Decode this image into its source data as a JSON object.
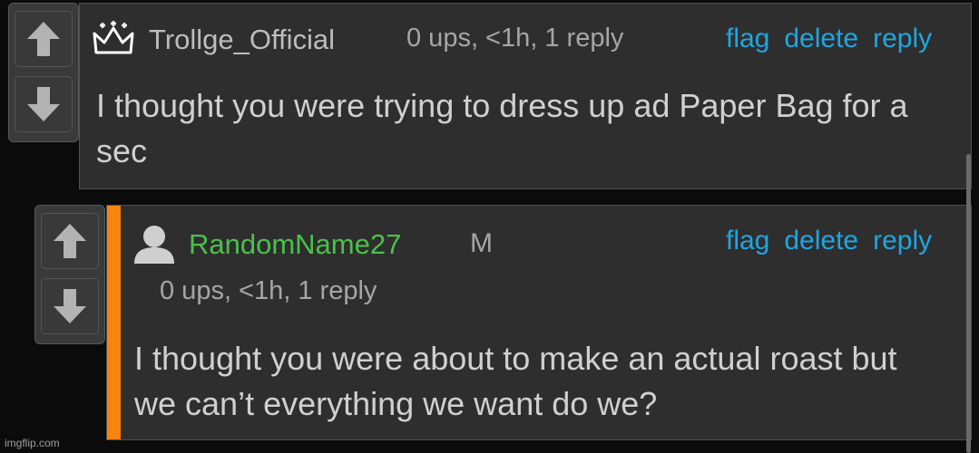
{
  "comments": [
    {
      "username": "Trollge_Official",
      "username_color": "#bdbdbd",
      "badge_icon": "crown-icon",
      "meta": "0 ups, <1h, 1 reply",
      "actions": {
        "flag": "flag",
        "delete": "delete",
        "reply": "reply"
      },
      "body": "I thought you were trying to dress up ad Paper Bag for a sec"
    },
    {
      "username": "RandomName27",
      "username_color": "#4bc04b",
      "avatar_icon": "default-avatar-icon",
      "gender": "M",
      "meta": "0 ups, <1h, 1 reply",
      "actions": {
        "flag": "flag",
        "delete": "delete",
        "reply": "reply"
      },
      "body": "I thought you were about to make an actual roast but we can’t everything we want do we?",
      "accent_color": "#f7840c"
    }
  ],
  "watermark": "imgflip.com",
  "link_color": "#1ea6e1"
}
